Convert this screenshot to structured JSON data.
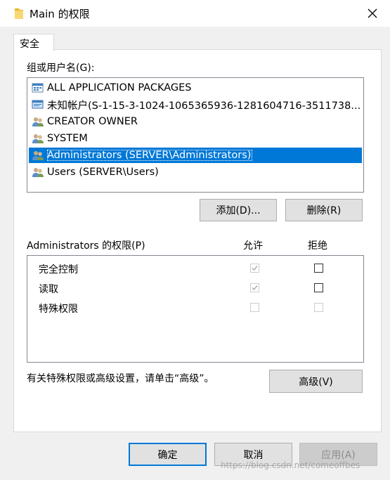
{
  "window": {
    "title": "Main 的权限"
  },
  "tabs": [
    {
      "label": "安全"
    }
  ],
  "groups": {
    "label": "组或用户名(G):",
    "items": [
      {
        "name": "ALL APPLICATION PACKAGES",
        "icon": "app-packages-icon"
      },
      {
        "name": "未知帐户(S-1-15-3-1024-1065365936-1281604716-3511738...",
        "icon": "unknown-account-icon"
      },
      {
        "name": "CREATOR OWNER",
        "icon": "users-group-icon"
      },
      {
        "name": "SYSTEM",
        "icon": "users-group-icon"
      },
      {
        "name": "Administrators (SERVER\\Administrators)",
        "icon": "users-group-icon",
        "selected": true
      },
      {
        "name": "Users (SERVER\\Users)",
        "icon": "users-group-icon"
      }
    ],
    "add_button": "添加(D)...",
    "remove_button": "删除(R)"
  },
  "permissions": {
    "label": "Administrators 的权限(P)",
    "allow_header": "允许",
    "deny_header": "拒绝",
    "rows": [
      {
        "name": "完全控制",
        "allow": true,
        "allow_disabled": true,
        "deny": false,
        "deny_disabled": false
      },
      {
        "name": "读取",
        "allow": true,
        "allow_disabled": true,
        "deny": false,
        "deny_disabled": false
      },
      {
        "name": "特殊权限",
        "allow": false,
        "allow_disabled": true,
        "deny": false,
        "deny_disabled": true
      }
    ]
  },
  "advanced": {
    "hint": "有关特殊权限或高级设置，请单击“高级”。",
    "button": "高级(V)"
  },
  "footer": {
    "ok": "确定",
    "cancel": "取消",
    "apply": "应用(A)"
  },
  "watermark": "https://blog.csdn.net/comeoffbes",
  "colors": {
    "selection": "#0078d7",
    "primary_border": "#0078d7"
  }
}
